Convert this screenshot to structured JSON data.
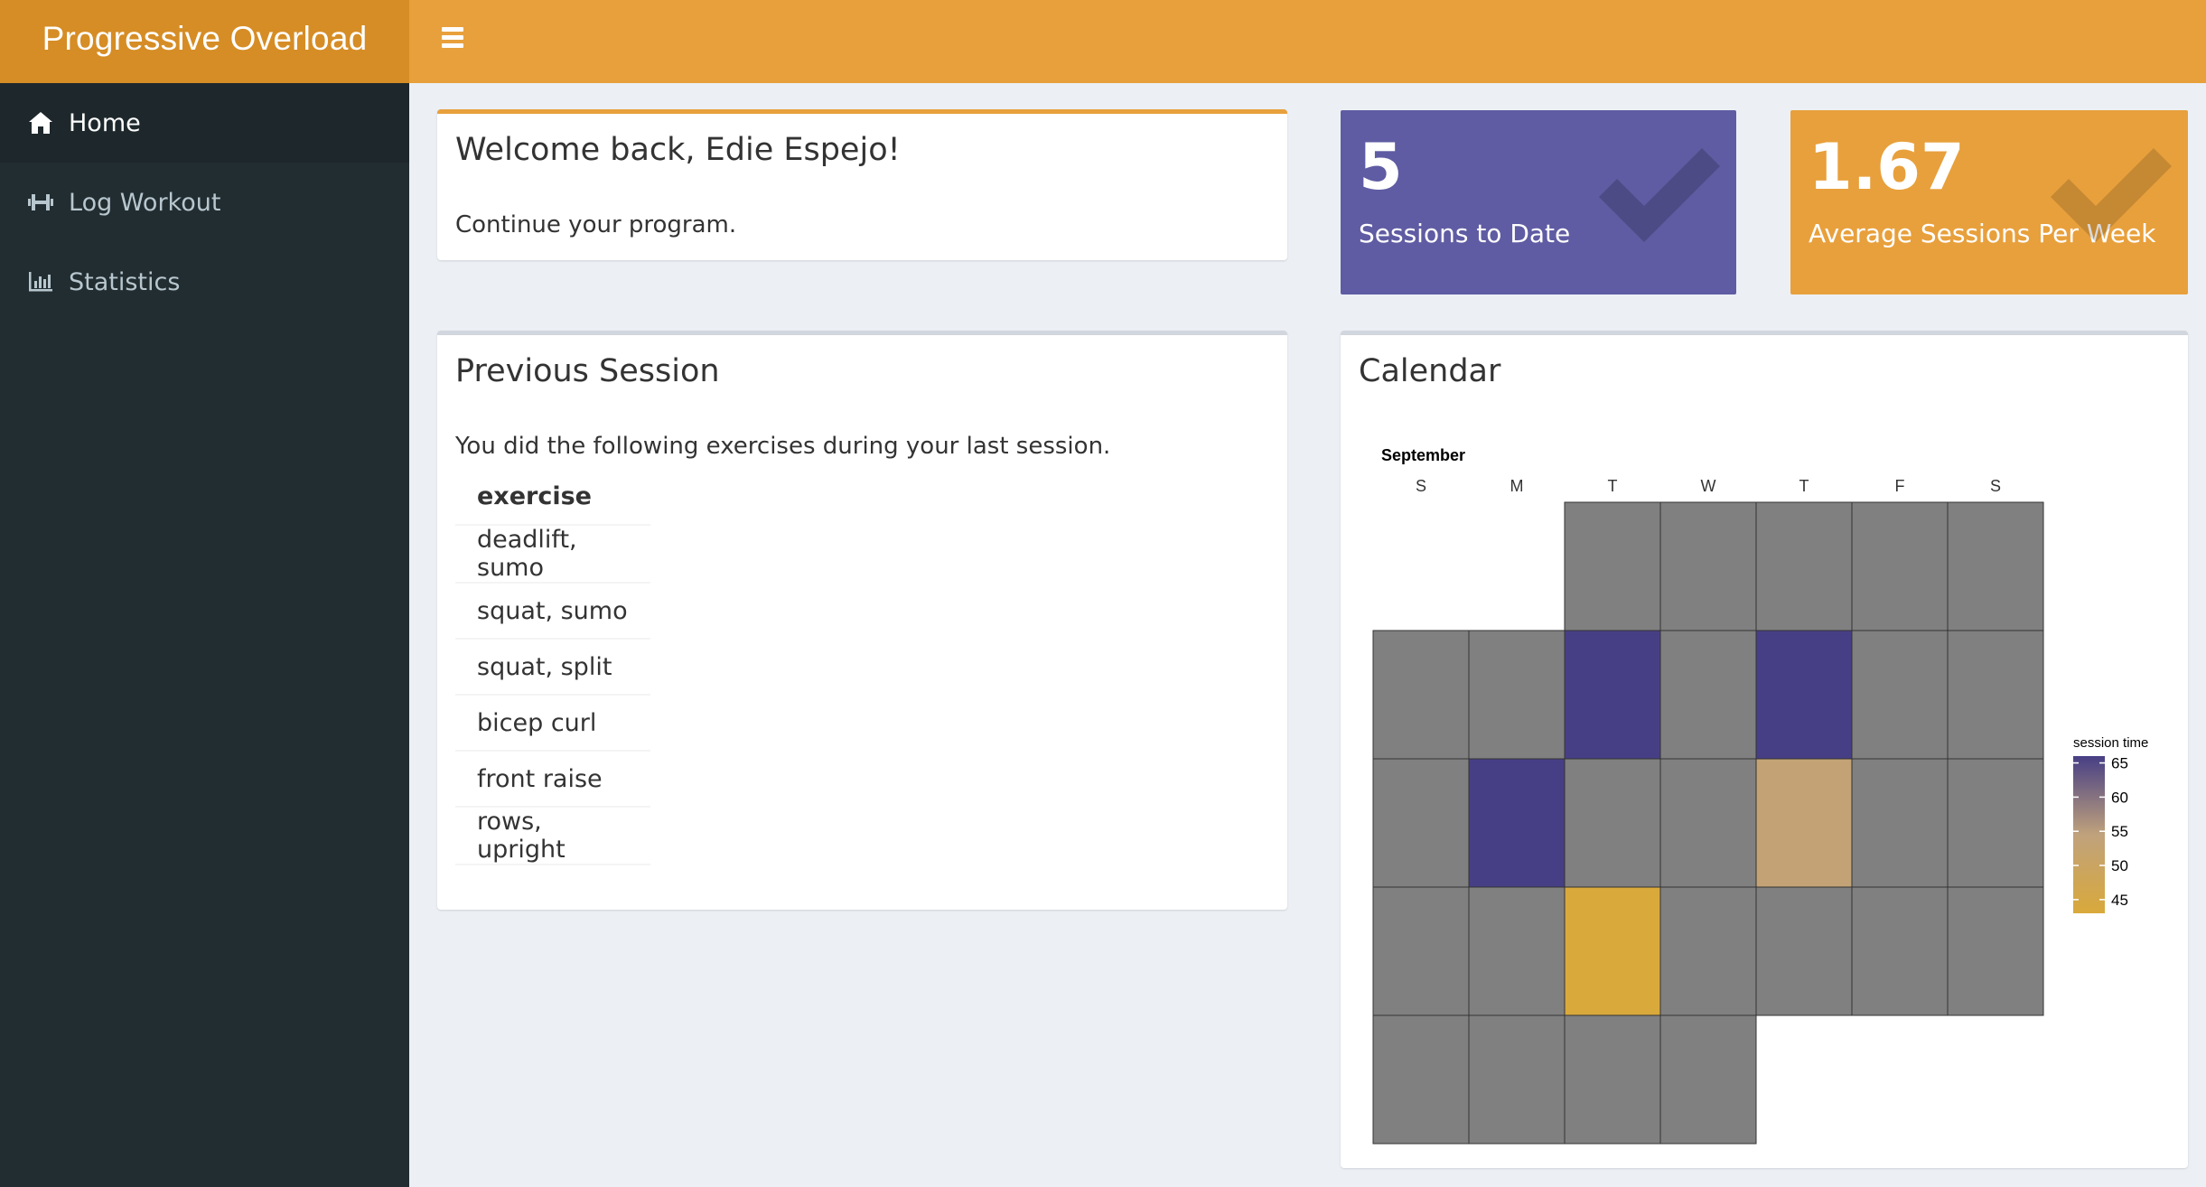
{
  "app": {
    "title": "Progressive Overload"
  },
  "sidebar": {
    "items": [
      {
        "label": "Home",
        "icon": "home-icon",
        "active": true
      },
      {
        "label": "Log Workout",
        "icon": "dumbbell-icon",
        "active": false
      },
      {
        "label": "Statistics",
        "icon": "bar-chart-icon",
        "active": false
      }
    ]
  },
  "welcome": {
    "title": "Welcome back, Edie Espejo!",
    "text": "Continue your program."
  },
  "value_boxes": [
    {
      "value": "5",
      "label": "Sessions to Date",
      "color": "#605ca8",
      "icon": "check-icon"
    },
    {
      "value": "1.67",
      "label": "Average Sessions Per Week",
      "color": "#e8a03c",
      "icon": "check-icon"
    }
  ],
  "previous_session": {
    "title": "Previous Session",
    "text": "You did the following exercises during your last session.",
    "table_header": "exercise",
    "rows": [
      "deadlift, sumo",
      "squat, sumo",
      "squat, split",
      "bicep curl",
      "front raise",
      "rows, upright"
    ]
  },
  "calendar": {
    "title": "Calendar",
    "month": "September",
    "weekdays": [
      "S",
      "M",
      "T",
      "W",
      "T",
      "F",
      "S"
    ],
    "legend_title": "session time",
    "legend_ticks": [
      65,
      60,
      55,
      50,
      45
    ],
    "legend_range": [
      43,
      66
    ],
    "colors": {
      "empty": "#808080",
      "low": "#d9a93b",
      "high": "#473f85"
    }
  },
  "chart_data": {
    "type": "heatmap",
    "title": "",
    "month": "September",
    "columns": [
      "S",
      "M",
      "T",
      "W",
      "T",
      "F",
      "S"
    ],
    "weeks": [
      [
        null,
        null,
        0,
        0,
        0,
        0,
        0
      ],
      [
        0,
        0,
        65,
        0,
        65,
        0,
        0
      ],
      [
        0,
        65,
        0,
        0,
        54,
        0,
        0
      ],
      [
        0,
        0,
        45,
        0,
        0,
        0,
        0
      ],
      [
        0,
        0,
        0,
        0,
        null,
        null,
        null
      ]
    ],
    "legend": "session time",
    "colorbar_ticks": [
      45,
      50,
      55,
      60,
      65
    ]
  }
}
